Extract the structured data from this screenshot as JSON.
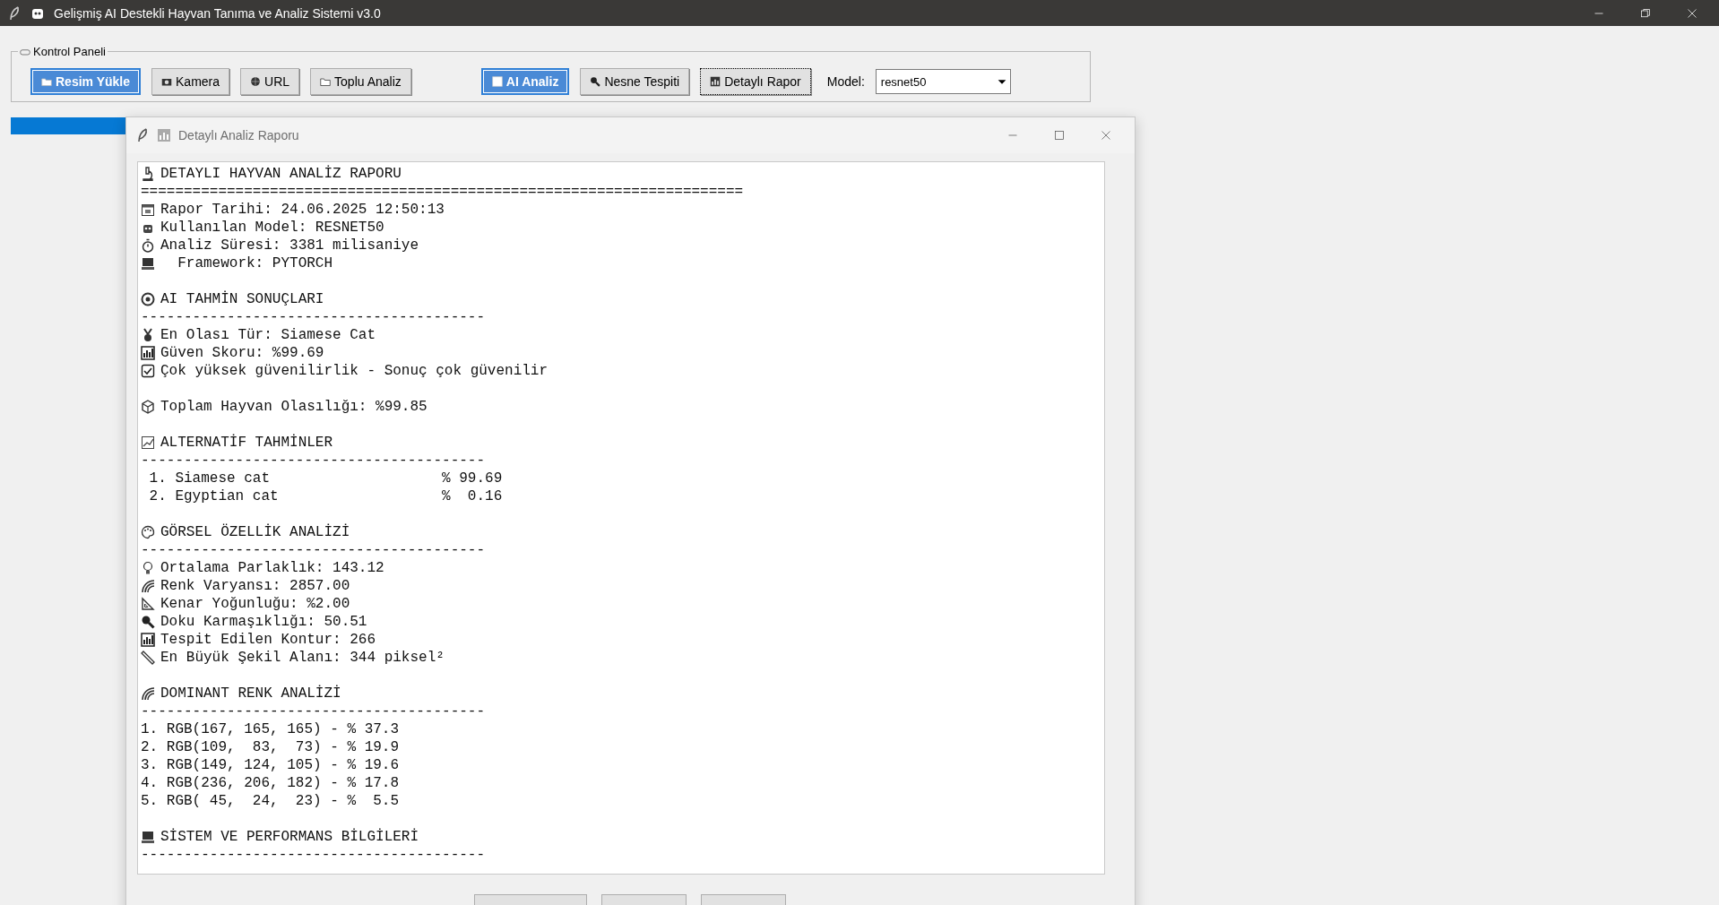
{
  "window": {
    "title": "Gelişmiş AI Destekli Hayvan Tanıma ve Analiz Sistemi v3.0"
  },
  "control_panel": {
    "title": "Kontrol Paneli",
    "buttons": [
      {
        "label": "Resim Yükle",
        "kind": "accent"
      },
      {
        "label": "Kamera",
        "kind": "normal"
      },
      {
        "label": "URL",
        "kind": "normal"
      },
      {
        "label": "Toplu Analiz",
        "kind": "normal"
      },
      {
        "label": "AI Analiz",
        "kind": "accent"
      },
      {
        "label": "Nesne Tespiti",
        "kind": "normal"
      },
      {
        "label": "Detaylı Rapor",
        "kind": "focused"
      }
    ],
    "model_label": "Model:",
    "model_value": "resnet50"
  },
  "progress": {
    "level": 1
  },
  "dialog": {
    "title": "Detaylı Analiz Raporu",
    "lines": [
      {
        "kind": "icon_text",
        "text": "DETAYLI HAYVAN ANALİZ RAPORU"
      },
      {
        "kind": "text",
        "text": "======================================================================"
      },
      {
        "kind": "icon_text",
        "text": "Rapor Tarihi: 24.06.2025 12:50:13"
      },
      {
        "kind": "icon_text",
        "text": "Kullanılan Model: RESNET50"
      },
      {
        "kind": "icon_text",
        "text": "Analiz Süresi: 3381 milisaniye"
      },
      {
        "kind": "icon_text",
        "text": "  Framework: PYTORCH"
      },
      {
        "kind": "blank"
      },
      {
        "kind": "icon_text",
        "text": "AI TAHMİN SONUÇLARI"
      },
      {
        "kind": "text",
        "text": "----------------------------------------"
      },
      {
        "kind": "icon_text",
        "text": "En Olası Tür: Siamese Cat"
      },
      {
        "kind": "icon_text",
        "text": "Güven Skoru: %99.69"
      },
      {
        "kind": "icon_text",
        "text": "Çok yüksek güvenilirlik - Sonuç çok güvenilir"
      },
      {
        "kind": "blank"
      },
      {
        "kind": "icon_text",
        "text": "Toplam Hayvan Olasılığı: %99.85"
      },
      {
        "kind": "blank"
      },
      {
        "kind": "icon_text",
        "text": "ALTERNATİF TAHMİNLER"
      },
      {
        "kind": "text",
        "text": "----------------------------------------"
      },
      {
        "kind": "text",
        "text": " 1. Siamese cat                    % 99.69"
      },
      {
        "kind": "text",
        "text": " 2. Egyptian cat                   %  0.16"
      },
      {
        "kind": "blank"
      },
      {
        "kind": "icon_text",
        "text": "GÖRSEL ÖZELLİK ANALİZİ"
      },
      {
        "kind": "text",
        "text": "----------------------------------------"
      },
      {
        "kind": "icon_text",
        "text": "Ortalama Parlaklık: 143.12"
      },
      {
        "kind": "icon_text",
        "text": "Renk Varyansı: 2857.00"
      },
      {
        "kind": "icon_text",
        "text": "Kenar Yoğunluğu: %2.00"
      },
      {
        "kind": "icon_text",
        "text": "Doku Karmaşıklığı: 50.51"
      },
      {
        "kind": "icon_text",
        "text": "Tespit Edilen Kontur: 266"
      },
      {
        "kind": "icon_text",
        "text": "En Büyük Şekil Alanı: 344 piksel²"
      },
      {
        "kind": "blank"
      },
      {
        "kind": "icon_text",
        "text": "DOMINANT RENK ANALİZİ"
      },
      {
        "kind": "text",
        "text": "----------------------------------------"
      },
      {
        "kind": "text",
        "text": "1. RGB(167, 165, 165) - % 37.3"
      },
      {
        "kind": "text",
        "text": "2. RGB(109,  83,  73) - % 19.9"
      },
      {
        "kind": "text",
        "text": "3. RGB(149, 124, 105) - % 19.6"
      },
      {
        "kind": "text",
        "text": "4. RGB(236, 206, 182) - % 17.8"
      },
      {
        "kind": "text",
        "text": "5. RGB( 45,  24,  23) - %  5.5"
      },
      {
        "kind": "blank"
      },
      {
        "kind": "icon_text",
        "text": "SİSTEM VE PERFORMANS BİLGİLERİ"
      },
      {
        "kind": "text",
        "text": "----------------------------------------"
      }
    ]
  }
}
